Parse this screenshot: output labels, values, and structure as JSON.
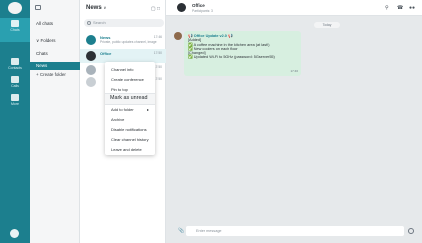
{
  "rail": {
    "items": [
      {
        "label": "Chats"
      },
      {
        "label": "Contacts"
      },
      {
        "label": "Calls"
      },
      {
        "label": "More"
      }
    ]
  },
  "folders": {
    "items": [
      {
        "label": "All chats"
      },
      {
        "label": "∨ Folders"
      },
      {
        "label": "Chats"
      },
      {
        "label": "News"
      },
      {
        "label": "+ Create folder"
      }
    ]
  },
  "chatlist": {
    "title": "News",
    "title_chevron": "∨",
    "search_placeholder": "Search",
    "chats": [
      {
        "name": "News",
        "preview": "Private, public updates channel, image",
        "time": "17:46"
      },
      {
        "name": "Office",
        "preview": "",
        "time": "17:50"
      },
      {
        "name": "",
        "preview": "public",
        "time": "17:50"
      },
      {
        "name": "",
        "preview": "",
        "time": "17:50"
      }
    ]
  },
  "context_menu": {
    "items": [
      "Channel info",
      "Create conference",
      "Pin to top",
      "Mark as unread",
      "Add to folder",
      "Archive",
      "Disable notifications",
      "Clear channel history",
      "Leave and delete"
    ],
    "submenu_arrow": "▸"
  },
  "conversation": {
    "name": "Office",
    "subtitle": "Participants: 3",
    "date_chip": "Today",
    "message": {
      "title": "📢 Office Update v2.0 📢",
      "lines": [
        "[Added]",
        "✅ A coffee machine in the kitchen area (at last!)",
        "✅ New coolers on each floor",
        "[Changed]",
        "✅ Updated Wi-Fi to 5GHz (password: 5Gserver55)"
      ],
      "time": "17:46"
    },
    "input_placeholder": "Enter message"
  }
}
